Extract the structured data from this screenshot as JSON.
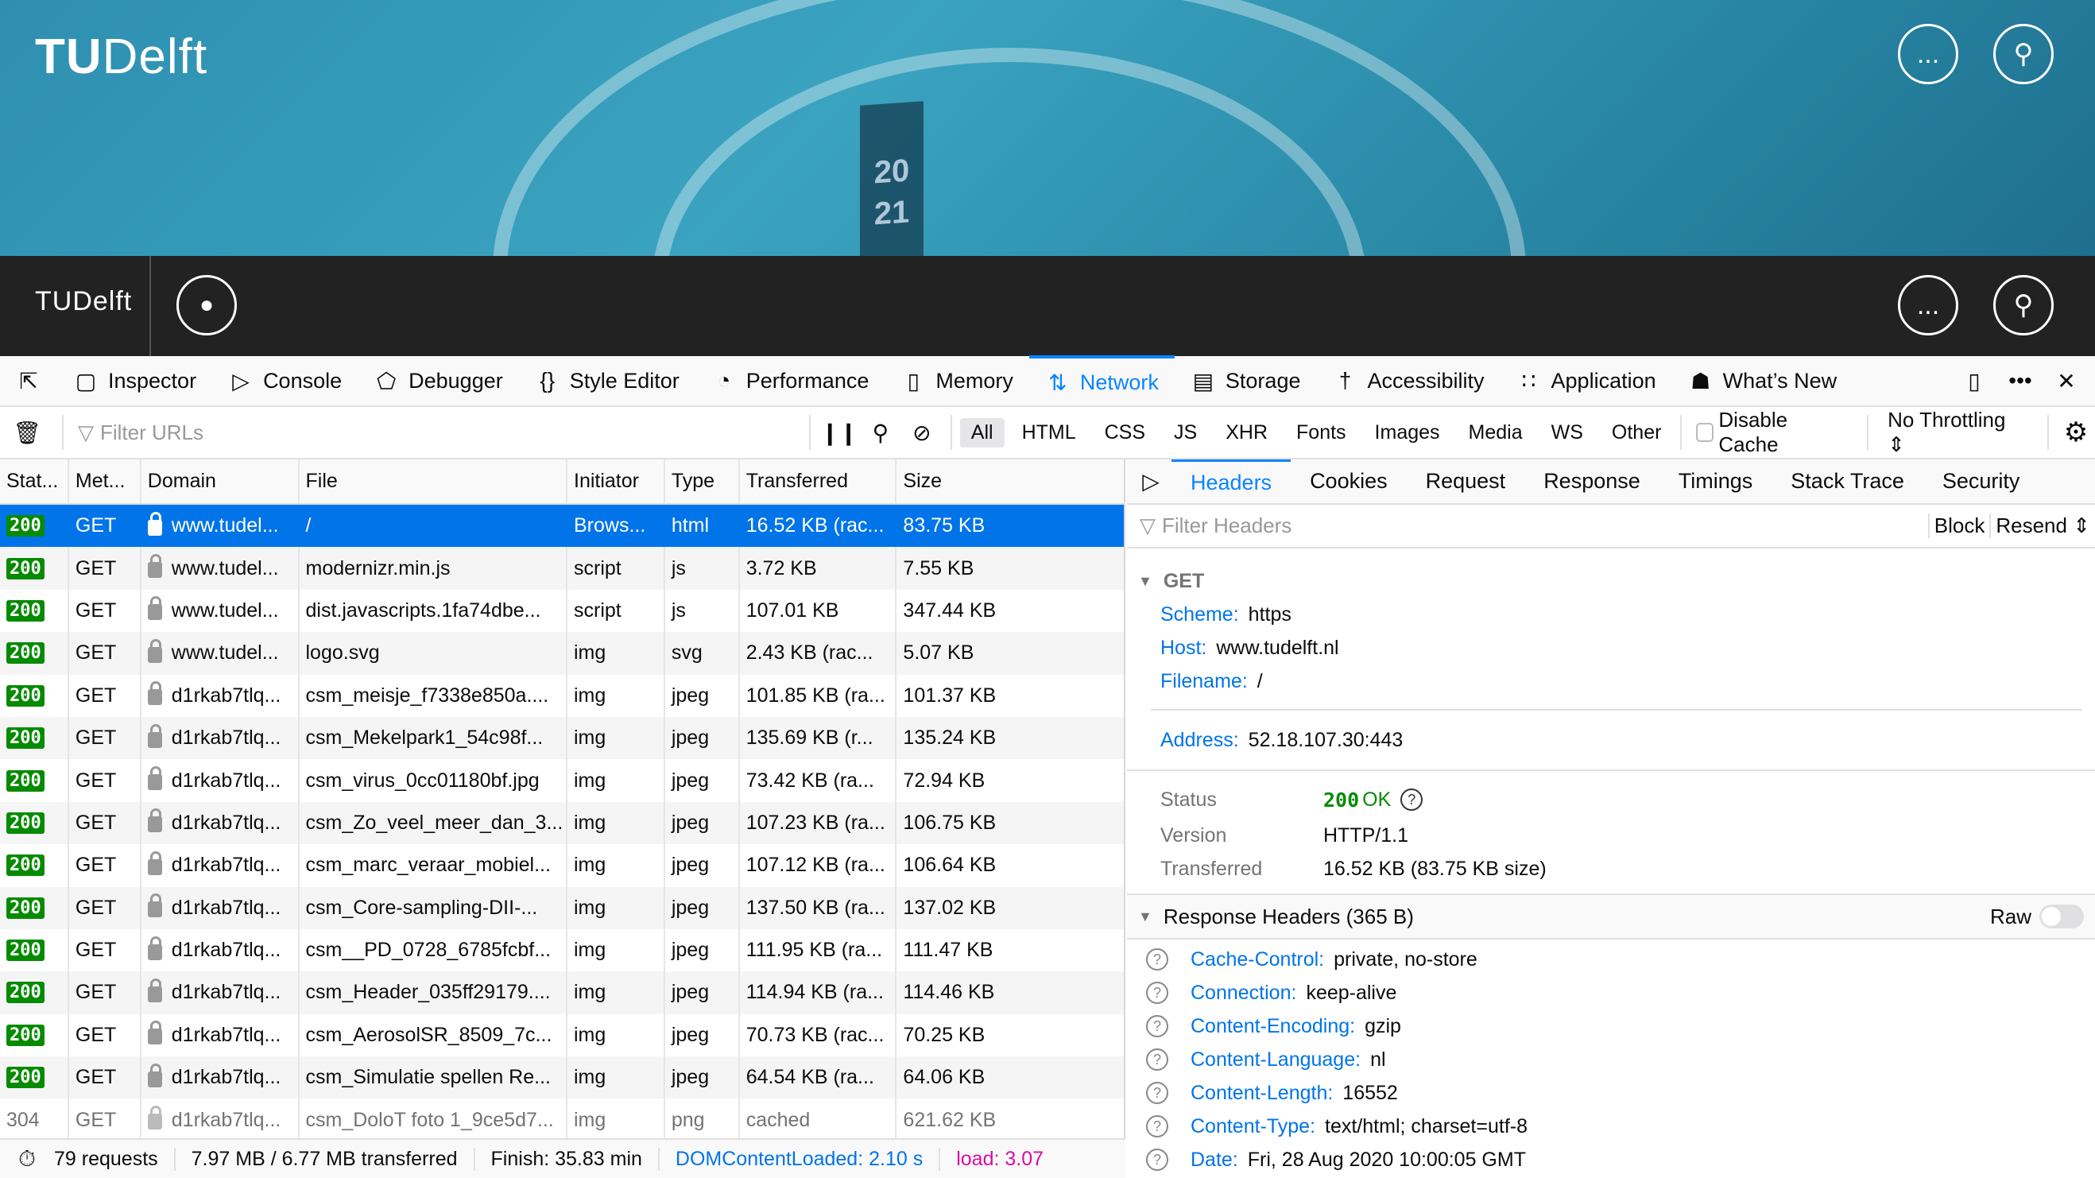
{
  "site": {
    "logo_main": "TU",
    "logo_sub": "Delft",
    "more_label": "...",
    "hero_text": "20 21"
  },
  "toolbar": {
    "tools": [
      {
        "label": "Inspector",
        "icon": "inspector-icon"
      },
      {
        "label": "Console",
        "icon": "console-icon"
      },
      {
        "label": "Debugger",
        "icon": "debugger-icon"
      },
      {
        "label": "Style Editor",
        "icon": "braces-icon"
      },
      {
        "label": "Performance",
        "icon": "gauge-icon"
      },
      {
        "label": "Memory",
        "icon": "chip-icon"
      },
      {
        "label": "Network",
        "icon": "arrows-up-down-icon",
        "active": true
      },
      {
        "label": "Storage",
        "icon": "storage-icon"
      },
      {
        "label": "Accessibility",
        "icon": "accessibility-icon"
      },
      {
        "label": "Application",
        "icon": "grid-icon"
      },
      {
        "label": "What’s New",
        "icon": "gift-icon"
      }
    ]
  },
  "filter": {
    "placeholder": "Filter URLs",
    "types": [
      "All",
      "HTML",
      "CSS",
      "JS",
      "XHR",
      "Fonts",
      "Images",
      "Media",
      "WS",
      "Other"
    ],
    "selected_type": "All",
    "disable_cache": "Disable Cache",
    "disable_cache_checked": false,
    "throttling": "No Throttling"
  },
  "table": {
    "columns": [
      "Stat...",
      "Met...",
      "Domain",
      "File",
      "Initiator",
      "Type",
      "Transferred",
      "Size"
    ],
    "rows": [
      [
        "200",
        "GET",
        "www.tudel...",
        "/",
        "Brows...",
        "html",
        "16.52 KB (rac...",
        "83.75 KB"
      ],
      [
        "200",
        "GET",
        "www.tudel...",
        "modernizr.min.js",
        "script",
        "js",
        "3.72 KB",
        "7.55 KB"
      ],
      [
        "200",
        "GET",
        "www.tudel...",
        "dist.javascripts.1fa74dbe...",
        "script",
        "js",
        "107.01 KB",
        "347.44 KB"
      ],
      [
        "200",
        "GET",
        "www.tudel...",
        "logo.svg",
        "img",
        "svg",
        "2.43 KB (rac...",
        "5.07 KB"
      ],
      [
        "200",
        "GET",
        "d1rkab7tlq...",
        "csm_meisje_f7338e850a....",
        "img",
        "jpeg",
        "101.85 KB (ra...",
        "101.37 KB"
      ],
      [
        "200",
        "GET",
        "d1rkab7tlq...",
        "csm_Mekelpark1_54c98f...",
        "img",
        "jpeg",
        "135.69 KB (r...",
        "135.24 KB"
      ],
      [
        "200",
        "GET",
        "d1rkab7tlq...",
        "csm_virus_0cc01180bf.jpg",
        "img",
        "jpeg",
        "73.42 KB (ra...",
        "72.94 KB"
      ],
      [
        "200",
        "GET",
        "d1rkab7tlq...",
        "csm_Zo_veel_meer_dan_3...",
        "img",
        "jpeg",
        "107.23 KB (ra...",
        "106.75 KB"
      ],
      [
        "200",
        "GET",
        "d1rkab7tlq...",
        "csm_marc_veraar_mobiel...",
        "img",
        "jpeg",
        "107.12 KB (ra...",
        "106.64 KB"
      ],
      [
        "200",
        "GET",
        "d1rkab7tlq...",
        "csm_Core-sampling-DII-...",
        "img",
        "jpeg",
        "137.50 KB (ra...",
        "137.02 KB"
      ],
      [
        "200",
        "GET",
        "d1rkab7tlq...",
        "csm__PD_0728_6785fcbf...",
        "img",
        "jpeg",
        "111.95 KB (ra...",
        "111.47 KB"
      ],
      [
        "200",
        "GET",
        "d1rkab7tlq...",
        "csm_Header_035ff29179....",
        "img",
        "jpeg",
        "114.94 KB (ra...",
        "114.46 KB"
      ],
      [
        "200",
        "GET",
        "d1rkab7tlq...",
        "csm_AerosolSR_8509_7c...",
        "img",
        "jpeg",
        "70.73 KB (rac...",
        "70.25 KB"
      ],
      [
        "200",
        "GET",
        "d1rkab7tlq...",
        "csm_Simulatie spellen Re...",
        "img",
        "jpeg",
        "64.54 KB (ra...",
        "64.06 KB"
      ],
      [
        "304",
        "GET",
        "d1rkab7tlq...",
        "csm_DoloT foto 1_9ce5d7...",
        "img",
        "png",
        "cached",
        "621.62 KB"
      ]
    ],
    "selected_row": 0
  },
  "status": {
    "requests": "79 requests",
    "transferred": "7.97 MB / 6.77 MB transferred",
    "finish": "Finish: 35.83 min",
    "dom": "DOMContentLoaded: 2.10 s",
    "load": "load: 3.07"
  },
  "side": {
    "tabs": [
      "Headers",
      "Cookies",
      "Request",
      "Response",
      "Timings",
      "Stack Trace",
      "Security"
    ],
    "active_tab": "Headers",
    "filter_placeholder": "Filter Headers",
    "block": "Block",
    "resend": "Resend",
    "method": "GET",
    "request": [
      {
        "k": "Scheme:",
        "v": "https"
      },
      {
        "k": "Host:",
        "v": "www.tudelft.nl"
      },
      {
        "k": "Filename:",
        "v": "/"
      }
    ],
    "address": {
      "k": "Address:",
      "v": "52.18.107.30:443"
    },
    "status_label": "Status",
    "status_code": "200",
    "status_text": "OK",
    "version_label": "Version",
    "version": "HTTP/1.1",
    "transferred_label": "Transferred",
    "transferred": "16.52 KB (83.75 KB size)",
    "response_title": "Response Headers (365 B)",
    "raw": "Raw",
    "response_headers": [
      {
        "k": "Cache-Control:",
        "v": "private, no-store"
      },
      {
        "k": "Connection:",
        "v": "keep-alive"
      },
      {
        "k": "Content-Encoding:",
        "v": "gzip"
      },
      {
        "k": "Content-Language:",
        "v": "nl"
      },
      {
        "k": "Content-Length:",
        "v": "16552"
      },
      {
        "k": "Content-Type:",
        "v": "text/html; charset=utf-8"
      },
      {
        "k": "Date:",
        "v": "Fri, 28 Aug 2020 10:00:05 GMT"
      }
    ]
  },
  "colors": {
    "accent": "#0a84ff",
    "selected_row": "#0074e8",
    "status_ok": "#058b00",
    "load": "#d70ea3"
  }
}
